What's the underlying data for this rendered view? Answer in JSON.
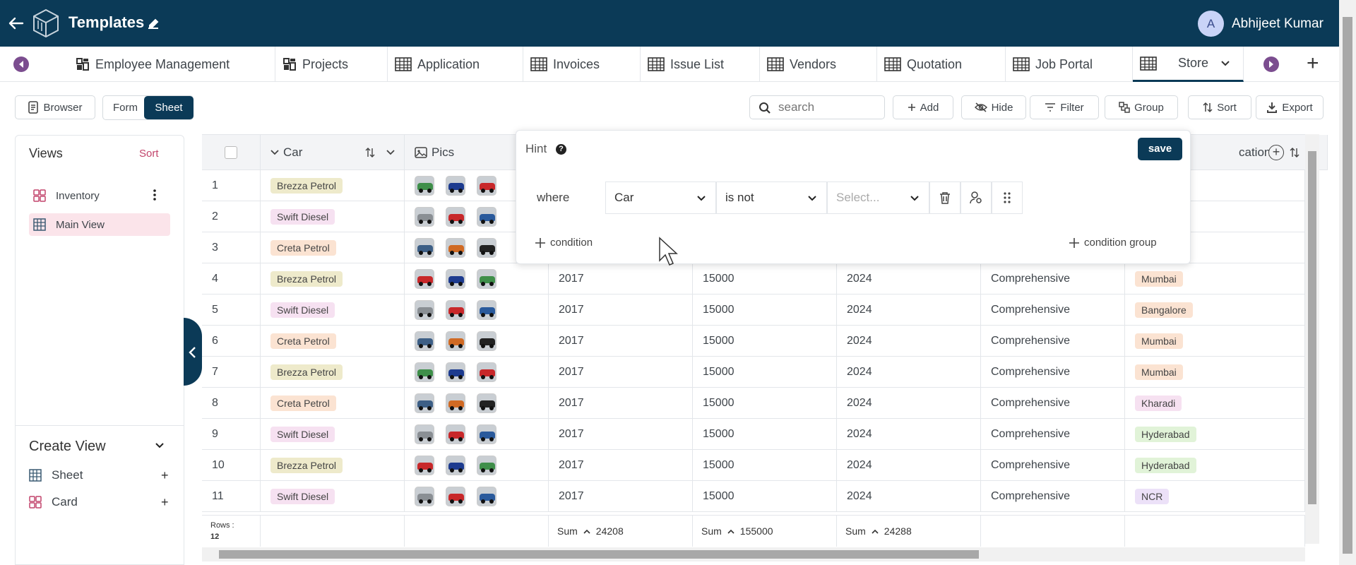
{
  "header": {
    "title": "Templates",
    "user_initial": "A",
    "user_name": "Abhijeet Kumar",
    "bg_color": "#0b3a57"
  },
  "tabs": [
    {
      "label": "Employee Management",
      "icon": "grid-icon"
    },
    {
      "label": "Projects",
      "icon": "grid-icon"
    },
    {
      "label": "Application",
      "icon": "table-icon"
    },
    {
      "label": "Invoices",
      "icon": "table-icon"
    },
    {
      "label": "Issue List",
      "icon": "table-icon"
    },
    {
      "label": "Vendors",
      "icon": "table-icon"
    },
    {
      "label": "Quotation",
      "icon": "table-icon"
    },
    {
      "label": "Job Portal",
      "icon": "table-icon"
    },
    {
      "label": "Store",
      "icon": "table-icon",
      "active": true
    }
  ],
  "toolbar": {
    "browser": "Browser",
    "form": "Form",
    "sheet": "Sheet",
    "search_placeholder": "search",
    "add": "Add",
    "hide": "Hide",
    "filter": "Filter",
    "group": "Group",
    "sort": "Sort",
    "export": "Export"
  },
  "sidebar": {
    "views_title": "Views",
    "sort_label": "Sort",
    "views": [
      {
        "label": "Inventory",
        "icon": "card-icon"
      },
      {
        "label": "Main View",
        "icon": "sheet-icon",
        "active": true
      }
    ],
    "create_view_title": "Create View",
    "create_items": [
      {
        "label": "Sheet",
        "icon": "sheet-icon",
        "add": "+"
      },
      {
        "label": "Card",
        "icon": "card-icon",
        "add": "+"
      }
    ]
  },
  "grid": {
    "columns": {
      "car": "Car",
      "pics": "Pics",
      "location_partial": "cation"
    },
    "rows": [
      {
        "num": "1",
        "car": "Brezza Petrol",
        "year": "",
        "price": "",
        "reg": "",
        "ins": "",
        "loc": ""
      },
      {
        "num": "2",
        "car": "Swift Diesel",
        "year": "",
        "price": "",
        "reg": "",
        "ins": "",
        "loc": ""
      },
      {
        "num": "3",
        "car": "Creta Petrol",
        "year": "",
        "price": "",
        "reg": "",
        "ins": "",
        "loc": ""
      },
      {
        "num": "4",
        "car": "Brezza Petrol",
        "year": "2017",
        "price": "15000",
        "reg": "2024",
        "ins": "Comprehensive",
        "loc": "Mumbai"
      },
      {
        "num": "5",
        "car": "Swift Diesel",
        "year": "2017",
        "price": "15000",
        "reg": "2024",
        "ins": "Comprehensive",
        "loc": "Bangalore"
      },
      {
        "num": "6",
        "car": "Creta Petrol",
        "year": "2017",
        "price": "15000",
        "reg": "2024",
        "ins": "Comprehensive",
        "loc": "Mumbai"
      },
      {
        "num": "7",
        "car": "Brezza Petrol",
        "year": "2017",
        "price": "15000",
        "reg": "2024",
        "ins": "Comprehensive",
        "loc": "Mumbai"
      },
      {
        "num": "8",
        "car": "Creta Petrol",
        "year": "2017",
        "price": "15000",
        "reg": "2024",
        "ins": "Comprehensive",
        "loc": "Kharadi"
      },
      {
        "num": "9",
        "car": "Swift Diesel",
        "year": "2017",
        "price": "15000",
        "reg": "2024",
        "ins": "Comprehensive",
        "loc": "Hyderabad"
      },
      {
        "num": "10",
        "car": "Brezza Petrol",
        "year": "2017",
        "price": "15000",
        "reg": "2024",
        "ins": "Comprehensive",
        "loc": "Hyderabad"
      },
      {
        "num": "11",
        "car": "Swift Diesel",
        "year": "2017",
        "price": "15000",
        "reg": "2024",
        "ins": "Comprehensive",
        "loc": "NCR"
      }
    ],
    "footer": {
      "rows_label": "Rows :",
      "rows_count": "12",
      "sum_label": "Sum",
      "sum_year": "24208",
      "sum_price": "155000",
      "sum_reg": "24288"
    },
    "chip_colors": {
      "Brezza Petrol": "#eeeacb",
      "Swift Diesel": "#f6e1f1",
      "Creta Petrol": "#fbe3d2",
      "Mumbai": "#fbe3d2",
      "Bangalore": "#fbe3d2",
      "Kharadi": "#f6e1f1",
      "Hyderabad": "#e1f3d8",
      "NCR": "#ece1f8"
    }
  },
  "filter_popover": {
    "hint": "Hint",
    "save": "save",
    "where": "where",
    "field": "Car",
    "operator": "is not",
    "value_placeholder": "Select...",
    "add_condition": "condition",
    "add_condition_group": "condition group"
  }
}
